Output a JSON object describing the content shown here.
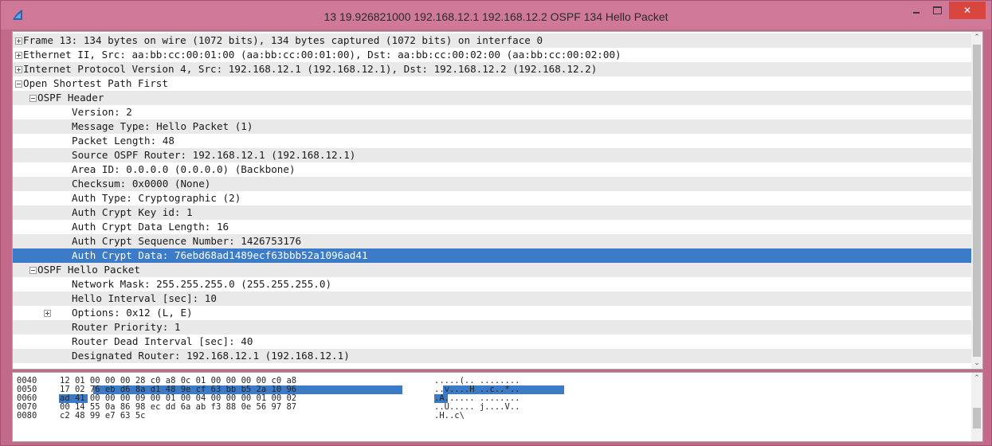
{
  "window": {
    "title": "13 19.926821000 192.168.12.1 192.168.12.2 OSPF 134 Hello Packet",
    "icon": "wireshark-fin-icon",
    "close_glyph": "✕"
  },
  "detail_tree": [
    {
      "text": "Frame 13: 134 bytes on wire (1072 bits), 134 bytes captured (1072 bits) on interface 0",
      "toggle": "collapsed"
    },
    {
      "text": "Ethernet II, Src: aa:bb:cc:00:01:00 (aa:bb:cc:00:01:00), Dst: aa:bb:cc:00:02:00 (aa:bb:cc:00:02:00)",
      "toggle": "collapsed"
    },
    {
      "text": "Internet Protocol Version 4, Src: 192.168.12.1 (192.168.12.1), Dst: 192.168.12.2 (192.168.12.2)",
      "toggle": "collapsed"
    },
    {
      "text": "Open Shortest Path First",
      "toggle": "expanded"
    },
    {
      "text": "OSPF Header",
      "toggle": "expanded"
    },
    {
      "text": "Version: 2"
    },
    {
      "text": "Message Type: Hello Packet (1)"
    },
    {
      "text": "Packet Length: 48"
    },
    {
      "text": "Source OSPF Router: 192.168.12.1 (192.168.12.1)"
    },
    {
      "text": "Area ID: 0.0.0.0 (0.0.0.0) (Backbone)"
    },
    {
      "text": "Checksum: 0x0000 (None)"
    },
    {
      "text": "Auth Type: Cryptographic (2)"
    },
    {
      "text": "Auth Crypt Key id: 1"
    },
    {
      "text": "Auth Crypt Data Length: 16"
    },
    {
      "text": "Auth Crypt Sequence Number: 1426753176"
    },
    {
      "text": "Auth Crypt Data: 76ebd68ad1489ecf63bbb52a1096ad41",
      "selected": true
    },
    {
      "text": "OSPF Hello Packet",
      "toggle": "expanded"
    },
    {
      "text": "Network Mask: 255.255.255.0 (255.255.255.0)"
    },
    {
      "text": "Hello Interval [sec]: 10"
    },
    {
      "text": "Options: 0x12 (L, E)",
      "toggle": "collapsed"
    },
    {
      "text": "Router Priority: 1"
    },
    {
      "text": "Router Dead Interval [sec]: 40"
    },
    {
      "text": "Designated Router: 192.168.12.1 (192.168.12.1)"
    }
  ],
  "hex_dump": [
    {
      "offset": "0040",
      "bytes": "12 01 00 00 00 28 c0 a8  0c 01 00 00 00 00 c0 a8",
      "ascii": ".....(.. ........"
    },
    {
      "offset": "0050",
      "bytes": "17 02 76 eb d6 8a d1 48  9e cf 63 bb b5 2a 10 96",
      "ascii": "..v....H ..c..*.."
    },
    {
      "offset": "0060",
      "bytes": "ad 41 00 00 00 09 00 01  00 04 00 00 00 01 00 02",
      "ascii": ".A...... ........"
    },
    {
      "offset": "0070",
      "bytes": "00 14 55 0a 86 98 ec dd  6a ab f3 88 0e 56 97 87",
      "ascii": "..U..... j....V.."
    },
    {
      "offset": "0080",
      "bytes": "c2 48 99 e7 63 5c",
      "ascii": ".H..c\\"
    }
  ],
  "colors": {
    "selection": "#3b7bc8",
    "title_bar": "#d07898",
    "close_button": "#d9463f",
    "stripe": "#e9e9e9"
  }
}
